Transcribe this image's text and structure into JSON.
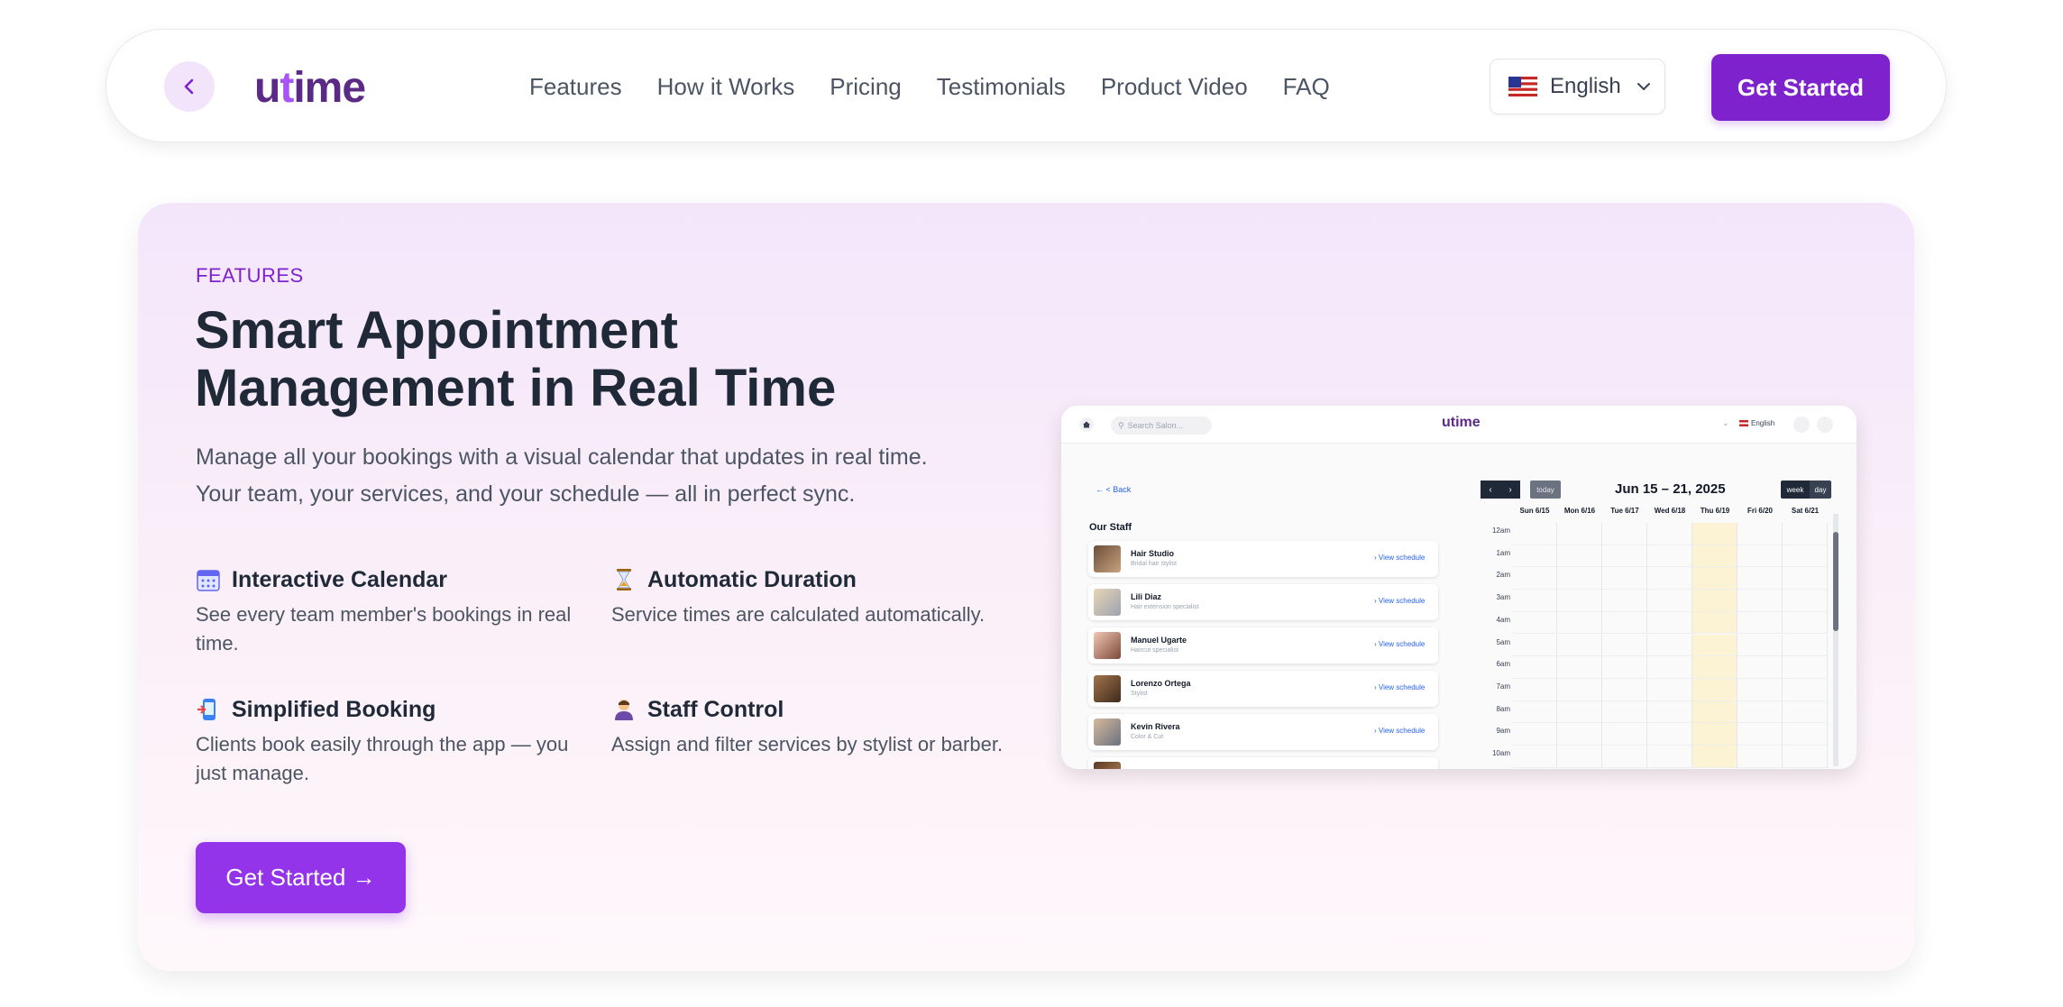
{
  "nav": {
    "logo": {
      "prefix": "u",
      "accent": "t",
      "suffix": "ime"
    },
    "links": [
      "Features",
      "How it Works",
      "Pricing",
      "Testimonials",
      "Product Video",
      "FAQ"
    ],
    "language": "English",
    "cta": "Get Started"
  },
  "hero": {
    "kicker": "FEATURES",
    "headline_line1": "Smart Appointment",
    "headline_line2": "Management in Real Time",
    "subtext_line1": "Manage all your bookings with a visual calendar that updates in real time.",
    "subtext_line2": "Your team, your services, and your schedule — all in perfect sync.",
    "features": [
      {
        "icon": "calendar-icon",
        "title": "Interactive Calendar",
        "desc": "See every team member's bookings in real time."
      },
      {
        "icon": "hourglass-icon",
        "title": "Automatic Duration",
        "desc": "Service times are calculated automatically."
      },
      {
        "icon": "phone-booking-icon",
        "title": "Simplified Booking",
        "desc": "Clients book easily through the app — you just manage."
      },
      {
        "icon": "person-icon",
        "title": "Staff Control",
        "desc": "Assign and filter services by stylist or barber."
      }
    ],
    "cta": "Get Started →"
  },
  "preview": {
    "search_placeholder": "Search Salon...",
    "logo": "utime",
    "language": "English",
    "back": "← < Back",
    "staff_title": "Our Staff",
    "staff": [
      {
        "name": "Hair Studio",
        "role": "Bridal hair stylist",
        "action": "› View schedule"
      },
      {
        "name": "Lili Diaz",
        "role": "Hair extension specialist",
        "action": "› View schedule"
      },
      {
        "name": "Manuel Ugarte",
        "role": "Haircut specialist",
        "action": "› View schedule"
      },
      {
        "name": "Lorenzo Ortega",
        "role": "Stylist",
        "action": "› View schedule"
      },
      {
        "name": "Kevin Rivera",
        "role": "Color & Cut",
        "action": "› View schedule"
      }
    ],
    "today": "today",
    "range": "Jun 15 – 21, 2025",
    "week": "week",
    "day": "day",
    "days": [
      "Sun 6/15",
      "Mon 6/16",
      "Tue 6/17",
      "Wed 6/18",
      "Thu 6/19",
      "Fri 6/20",
      "Sat 6/21"
    ],
    "hours": [
      "12am",
      "1am",
      "2am",
      "3am",
      "4am",
      "5am",
      "6am",
      "7am",
      "8am",
      "9am",
      "10am"
    ]
  },
  "colors": {
    "brand": "#7e22ce",
    "accent": "#9333ea",
    "today_highlight": "#fbf3d4"
  }
}
